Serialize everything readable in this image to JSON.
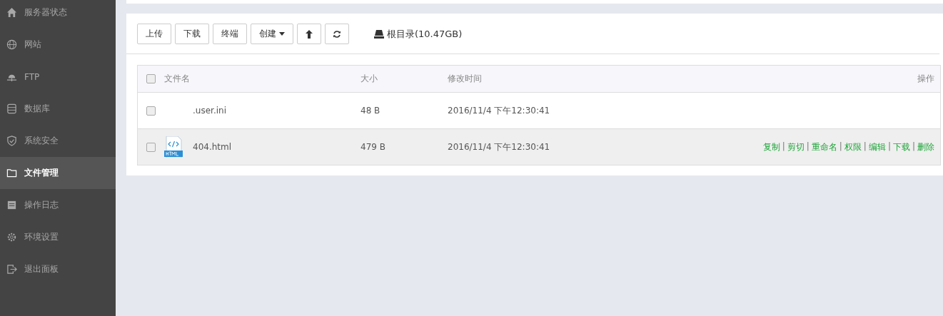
{
  "sidebar": {
    "items": [
      {
        "label": "服务器状态",
        "selected": false
      },
      {
        "label": "网站",
        "selected": false
      },
      {
        "label": "FTP",
        "selected": false
      },
      {
        "label": "数据库",
        "selected": false
      },
      {
        "label": "系统安全",
        "selected": false
      },
      {
        "label": "文件管理",
        "selected": true
      },
      {
        "label": "操作日志",
        "selected": false
      },
      {
        "label": "环境设置",
        "selected": false
      },
      {
        "label": "退出面板",
        "selected": false
      }
    ]
  },
  "toolbar": {
    "buttons": [
      {
        "kind": "text",
        "label": "上传"
      },
      {
        "kind": "text",
        "label": "下载"
      },
      {
        "kind": "text",
        "label": "终端"
      },
      {
        "kind": "dropdown",
        "label": "创建"
      },
      {
        "kind": "up"
      },
      {
        "kind": "refresh"
      }
    ],
    "path": "根目录(10.47GB)"
  },
  "table": {
    "columns": [
      "文件名",
      "大小",
      "修改时间",
      "操作"
    ],
    "header_checked": false,
    "rows": [
      {
        "checked": false,
        "kind": "plain",
        "name": ".user.ini",
        "size": "48 B",
        "modified": "2016/11/4 下午12:30:41",
        "highlighted": false
      },
      {
        "checked": false,
        "kind": "html",
        "name": "404.html",
        "size": "479 B",
        "modified": "2016/11/4 下午12:30:41",
        "highlighted": true,
        "actions": [
          "复制",
          "剪切",
          "重命名",
          "权限",
          "编辑",
          "下载",
          "删除"
        ],
        "separator": "|"
      }
    ]
  }
}
